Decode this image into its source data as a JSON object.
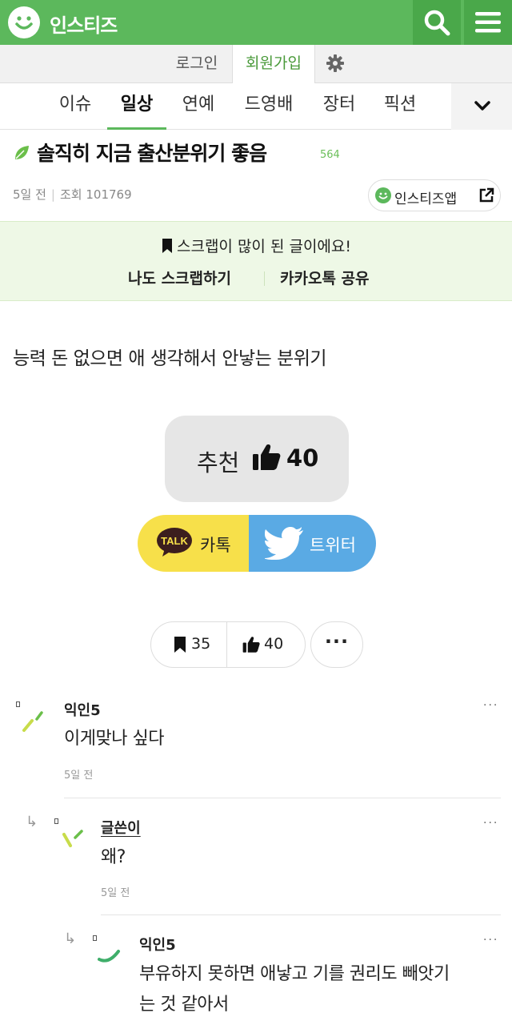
{
  "header": {
    "brand": "인스티즈",
    "colors": {
      "brand_green": "#5cb85c",
      "dark_green": "#4aa84a",
      "accent_text": "#4a9a3a"
    }
  },
  "auth": {
    "login": "로그인",
    "signup": "회원가입"
  },
  "nav": {
    "categories": [
      "이슈",
      "일상",
      "연예",
      "드영배",
      "장터",
      "픽션"
    ],
    "active": "일상"
  },
  "post": {
    "title": "솔직히 지금 출산분위기 좋음",
    "title_count": "564",
    "time": "5일 전",
    "views": "조회 101769",
    "app_button": "인스티즈앱",
    "body": "능력 돈 없으면 애 생각해서 안낳는 분위기"
  },
  "scrap_banner": {
    "message": "스크랩이 많이 된 글이에요!",
    "action_scrap": "나도 스크랩하기",
    "action_kakao": "카카오톡 공유"
  },
  "recommend": {
    "label": "추천",
    "count": "40"
  },
  "share": {
    "kakao_badge": "TALK",
    "kakao": "카톡",
    "twitter": "트위터"
  },
  "stats": {
    "scraps": "35",
    "likes": "40",
    "more": "···"
  },
  "comments": [
    {
      "name": "익인5",
      "text": "이게맞나 싶다",
      "time": "5일 전",
      "dots": "···"
    },
    {
      "name": "글쓴이",
      "text": "왜?",
      "time": "5일 전",
      "dots": "···"
    },
    {
      "name": "익인5",
      "text": "부유하지 못하면 애낳고 기를 권리도 빼앗기",
      "text2": "는 것 같아서",
      "dots": "···"
    }
  ],
  "icons": [
    "smile-logo-icon",
    "search-icon",
    "menu-icon",
    "gear-icon",
    "chevron-down-icon",
    "leaf-icon",
    "external-link-icon",
    "bookmark-icon",
    "thumbs-up-icon",
    "twitter-bird-icon",
    "reply-arrow-icon"
  ]
}
